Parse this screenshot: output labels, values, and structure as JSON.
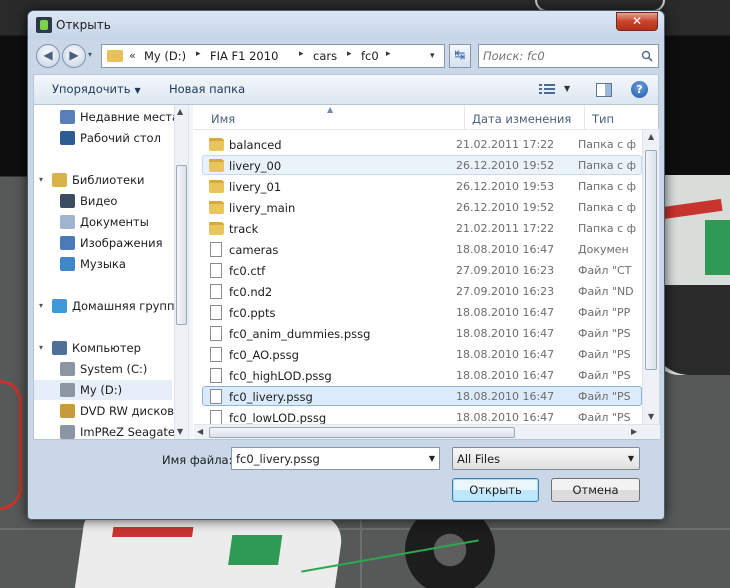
{
  "dialog": {
    "title": "Открыть",
    "close_glyph": "✕"
  },
  "address": {
    "back_glyph": "◀",
    "forward_glyph": "▶",
    "dropdown_glyph": "▾",
    "overflow_glyph": "«",
    "crumbs": [
      "My (D:)",
      "FIA F1 2010",
      "cars",
      "fc0"
    ],
    "separator": "▸",
    "refresh_glyph": "↹",
    "search_placeholder": "Поиск: fc0"
  },
  "toolbar": {
    "organize": "Упорядочить",
    "organize_arrow": "▼",
    "new_folder": "Новая папка",
    "view_arrow": "▼",
    "help": "?"
  },
  "sidebar": {
    "items": [
      {
        "label": "Недавние места",
        "icon": "recent-places-icon",
        "color": "#5a7fb8"
      },
      {
        "label": "Рабочий стол",
        "icon": "desktop-icon",
        "color": "#2c5c94"
      },
      {
        "label": "Библиотеки",
        "icon": "libraries-icon",
        "color": "#d8b24a"
      },
      {
        "label": "Видео",
        "icon": "video-icon",
        "color": "#3b4c63"
      },
      {
        "label": "Документы",
        "icon": "documents-icon",
        "color": "#9fb5cf"
      },
      {
        "label": "Изображения",
        "icon": "pictures-icon",
        "color": "#4b7bb7"
      },
      {
        "label": "Музыка",
        "icon": "music-icon",
        "color": "#3f87c9"
      },
      {
        "label": "Домашняя группа",
        "icon": "homegroup-icon",
        "color": "#3c9bd6"
      },
      {
        "label": "Компьютер",
        "icon": "computer-icon",
        "color": "#4e6f96"
      },
      {
        "label": "System (C:)",
        "icon": "drive-c-icon",
        "color": "#8c96a3"
      },
      {
        "label": "My (D:)",
        "icon": "drive-d-icon",
        "color": "#8c96a3"
      },
      {
        "label": "DVD RW дисково",
        "icon": "dvd-drive-icon",
        "color": "#c79a3a"
      },
      {
        "label": "ImPReZ Seagate",
        "icon": "external-drive-icon",
        "color": "#8c96a3"
      }
    ]
  },
  "columns": {
    "name": "Имя",
    "date": "Дата изменения",
    "type": "Тип"
  },
  "files": [
    {
      "name": "balanced",
      "date": "21.02.2011 17:22",
      "type": "Папка с ф",
      "kind": "folder"
    },
    {
      "name": "livery_00",
      "date": "26.12.2010 19:52",
      "type": "Папка с ф",
      "kind": "folder"
    },
    {
      "name": "livery_01",
      "date": "26.12.2010 19:53",
      "type": "Папка с ф",
      "kind": "folder"
    },
    {
      "name": "livery_main",
      "date": "26.12.2010 19:52",
      "type": "Папка с ф",
      "kind": "folder"
    },
    {
      "name": "track",
      "date": "21.02.2011 17:22",
      "type": "Папка с ф",
      "kind": "folder"
    },
    {
      "name": "cameras",
      "date": "18.08.2010 16:47",
      "type": "Докумен",
      "kind": "doc"
    },
    {
      "name": "fc0.ctf",
      "date": "27.09.2010 16:23",
      "type": "Файл \"CT",
      "kind": "file"
    },
    {
      "name": "fc0.nd2",
      "date": "27.09.2010 16:23",
      "type": "Файл \"ND",
      "kind": "file"
    },
    {
      "name": "fc0.ppts",
      "date": "18.08.2010 16:47",
      "type": "Файл \"PP",
      "kind": "file"
    },
    {
      "name": "fc0_anim_dummies.pssg",
      "date": "18.08.2010 16:47",
      "type": "Файл \"PS",
      "kind": "file"
    },
    {
      "name": "fc0_AO.pssg",
      "date": "18.08.2010 16:47",
      "type": "Файл \"PS",
      "kind": "file"
    },
    {
      "name": "fc0_highLOD.pssg",
      "date": "18.08.2010 16:47",
      "type": "Файл \"PS",
      "kind": "file"
    },
    {
      "name": "fc0_livery.pssg",
      "date": "18.08.2010 16:47",
      "type": "Файл \"PS",
      "kind": "file"
    },
    {
      "name": "fc0_lowLOD.pssg",
      "date": "18.08.2010 16:47",
      "type": "Файл \"PS",
      "kind": "file"
    }
  ],
  "footer": {
    "filename_label": "Имя файла:",
    "filename_value": "fc0_livery.pssg",
    "filter_value": "All Files",
    "open": "Открыть",
    "cancel": "Отмена"
  },
  "colors": {
    "accent": "#3c7fb1",
    "selection": "#dcebfc",
    "close": "#c7432c"
  }
}
